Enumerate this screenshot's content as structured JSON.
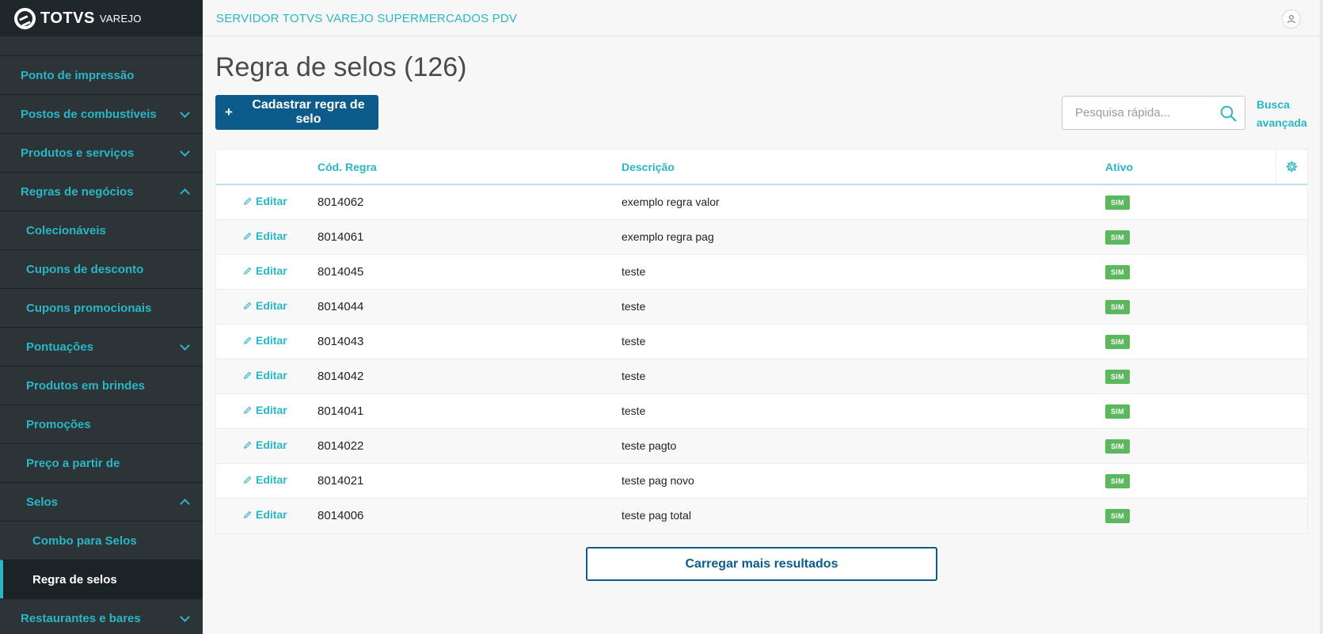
{
  "brand": {
    "name": "TOTVS",
    "sub": "VAREJO"
  },
  "sidebar": {
    "items": [
      {
        "label": "Ponto de impressão",
        "level": 0,
        "chevron": "none"
      },
      {
        "label": "Postos de combustíveis",
        "level": 0,
        "chevron": "down"
      },
      {
        "label": "Produtos e serviços",
        "level": 0,
        "chevron": "down"
      },
      {
        "label": "Regras de negócios",
        "level": 0,
        "chevron": "up"
      },
      {
        "label": "Colecionáveis",
        "level": 1,
        "chevron": "none"
      },
      {
        "label": "Cupons de desconto",
        "level": 1,
        "chevron": "none"
      },
      {
        "label": "Cupons promocionais",
        "level": 1,
        "chevron": "none"
      },
      {
        "label": "Pontuações",
        "level": 1,
        "chevron": "down"
      },
      {
        "label": "Produtos em brindes",
        "level": 1,
        "chevron": "none"
      },
      {
        "label": "Promoções",
        "level": 1,
        "chevron": "none"
      },
      {
        "label": "Preço a partir de",
        "level": 1,
        "chevron": "none"
      },
      {
        "label": "Selos",
        "level": 1,
        "chevron": "up"
      },
      {
        "label": "Combo para Selos",
        "level": 2,
        "chevron": "none"
      },
      {
        "label": "Regra de selos",
        "level": 2,
        "chevron": "none",
        "active": true
      },
      {
        "label": "Restaurantes e bares",
        "level": 0,
        "chevron": "down"
      }
    ]
  },
  "header": {
    "server_title": "SERVIDOR TOTVS VAREJO SUPERMERCADOS PDV",
    "user_icon": "user-icon"
  },
  "main": {
    "title": "Regra de selos (126)",
    "add_button": "Cadastrar regra de selo",
    "search_placeholder": "Pesquisa rápida...",
    "advanced_search": "Busca avançada",
    "load_more": "Carregar mais resultados"
  },
  "table": {
    "columns": [
      "Cód. Regra",
      "Descrição",
      "Ativo"
    ],
    "edit_label": "Editar",
    "rows": [
      {
        "code": "8014062",
        "description": "exemplo regra valor",
        "active": "SIM"
      },
      {
        "code": "8014061",
        "description": "exemplo regra pag",
        "active": "SIM"
      },
      {
        "code": "8014045",
        "description": "teste",
        "active": "SIM"
      },
      {
        "code": "8014044",
        "description": "teste",
        "active": "SIM"
      },
      {
        "code": "8014043",
        "description": "teste",
        "active": "SIM"
      },
      {
        "code": "8014042",
        "description": "teste",
        "active": "SIM"
      },
      {
        "code": "8014041",
        "description": "teste",
        "active": "SIM"
      },
      {
        "code": "8014022",
        "description": "teste pagto",
        "active": "SIM"
      },
      {
        "code": "8014021",
        "description": "teste pag novo",
        "active": "SIM"
      },
      {
        "code": "8014006",
        "description": "teste pag total",
        "active": "SIM"
      }
    ]
  },
  "colors": {
    "accent": "#29b6c5",
    "primary": "#0c5b8a",
    "sidebar": "#2c3438",
    "success": "#5cb85c"
  }
}
